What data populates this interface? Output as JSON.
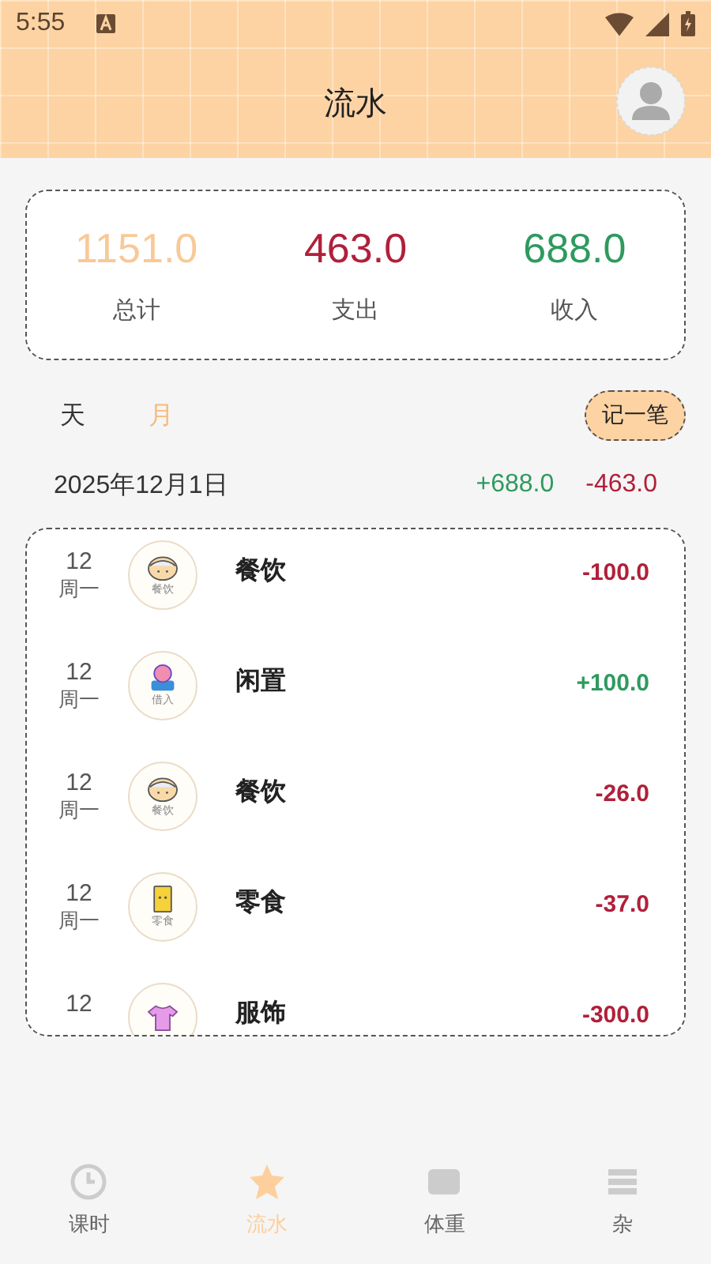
{
  "status_bar": {
    "time": "5:55"
  },
  "header": {
    "title": "流水"
  },
  "summary": [
    {
      "kind": "total",
      "value": "1151.0",
      "label": "总计"
    },
    {
      "kind": "expense",
      "value": "463.0",
      "label": "支出"
    },
    {
      "kind": "income",
      "value": "688.0",
      "label": "收入"
    }
  ],
  "period_tabs": [
    {
      "label": "天",
      "selected": false
    },
    {
      "label": "月",
      "selected": true
    }
  ],
  "add_button": "记一笔",
  "day_group": {
    "date": "2025年12月1日",
    "income": "+688.0",
    "expense": "-463.0"
  },
  "records": [
    {
      "day": "12",
      "weekday": "周一",
      "icon_label": "餐饮",
      "category": "餐饮",
      "amount": "-100.0",
      "kind": "expense"
    },
    {
      "day": "12",
      "weekday": "周一",
      "icon_label": "借入",
      "category": "闲置",
      "amount": "+100.0",
      "kind": "income"
    },
    {
      "day": "12",
      "weekday": "周一",
      "icon_label": "餐饮",
      "category": "餐饮",
      "amount": "-26.0",
      "kind": "expense"
    },
    {
      "day": "12",
      "weekday": "周一",
      "icon_label": "零食",
      "category": "零食",
      "amount": "-37.0",
      "kind": "expense"
    },
    {
      "day": "12",
      "category": "服饰",
      "amount": "-300.0",
      "kind": "expense"
    }
  ],
  "bottom_nav": [
    {
      "label": "课时",
      "selected": false
    },
    {
      "label": "流水",
      "selected": true
    },
    {
      "label": "体重",
      "selected": false
    },
    {
      "label": "杂",
      "selected": false
    }
  ]
}
